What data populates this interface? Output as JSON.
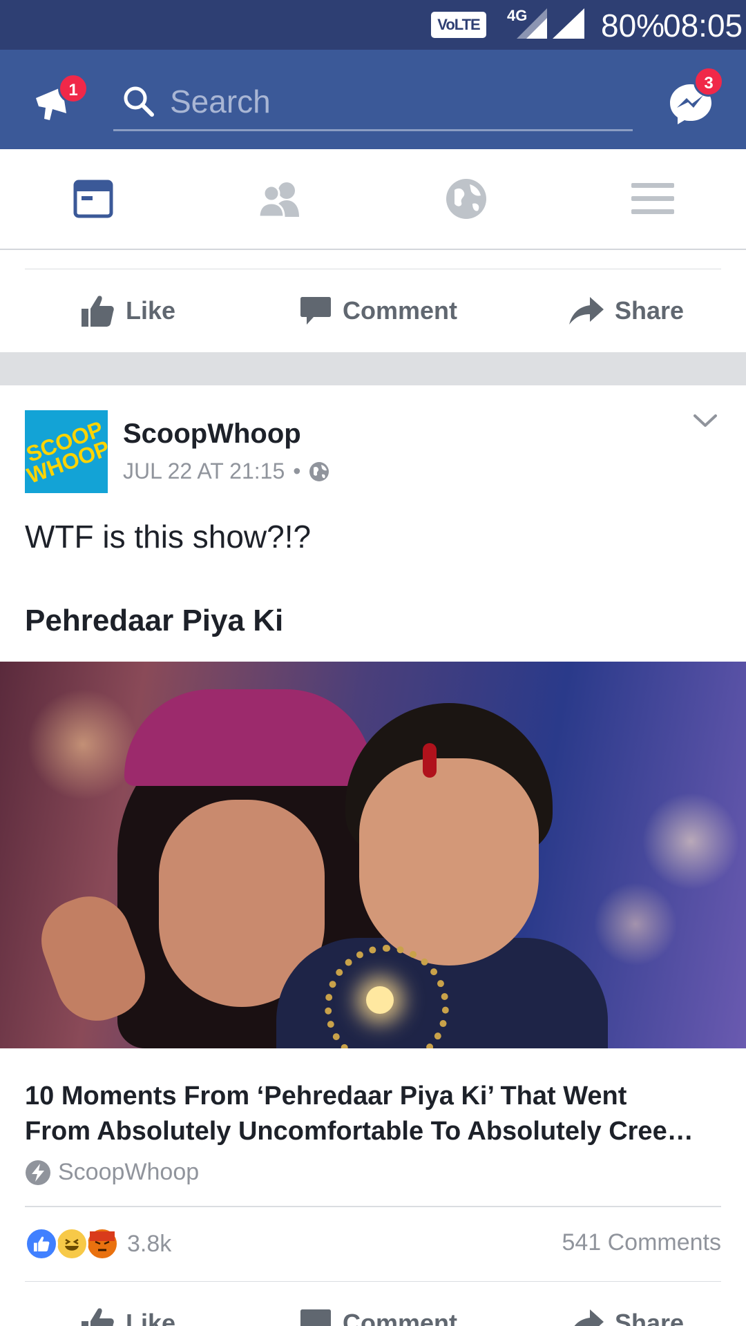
{
  "status_bar": {
    "volte": "VoLTE",
    "network": "4G",
    "battery": "80%",
    "time": "08:05"
  },
  "topbar": {
    "notification_badge": "1",
    "search_placeholder": "Search",
    "messenger_badge": "3"
  },
  "nav_tabs": [
    "news-feed-icon",
    "friends-icon",
    "globe-icon",
    "menu-icon"
  ],
  "action_bar": {
    "like": "Like",
    "comment": "Comment",
    "share": "Share"
  },
  "post": {
    "logo_text_line1": "SCOOP",
    "logo_text_line2": "WHOOP",
    "page_name": "ScoopWhoop",
    "timestamp": "JUL 22 AT 21:15",
    "dot": "•",
    "text": "WTF is this show?!?",
    "title": "Pehredaar Piya Ki",
    "article_title_line1": "10 Moments From ‘Pehredaar Piya Ki’ That Went",
    "article_title_line2": "From Absolutely Uncomfortable To Absolutely Cree…",
    "article_source": "ScoopWhoop",
    "reactions_count": "3.8k",
    "comments_count": "541 Comments"
  },
  "colors": {
    "brand_blue": "#3b5998",
    "status_blue": "#2e3f73",
    "badge_red": "#f02849",
    "muted_text": "#90949c",
    "logo_bg": "#13a3d6",
    "logo_text": "#ffd400"
  }
}
